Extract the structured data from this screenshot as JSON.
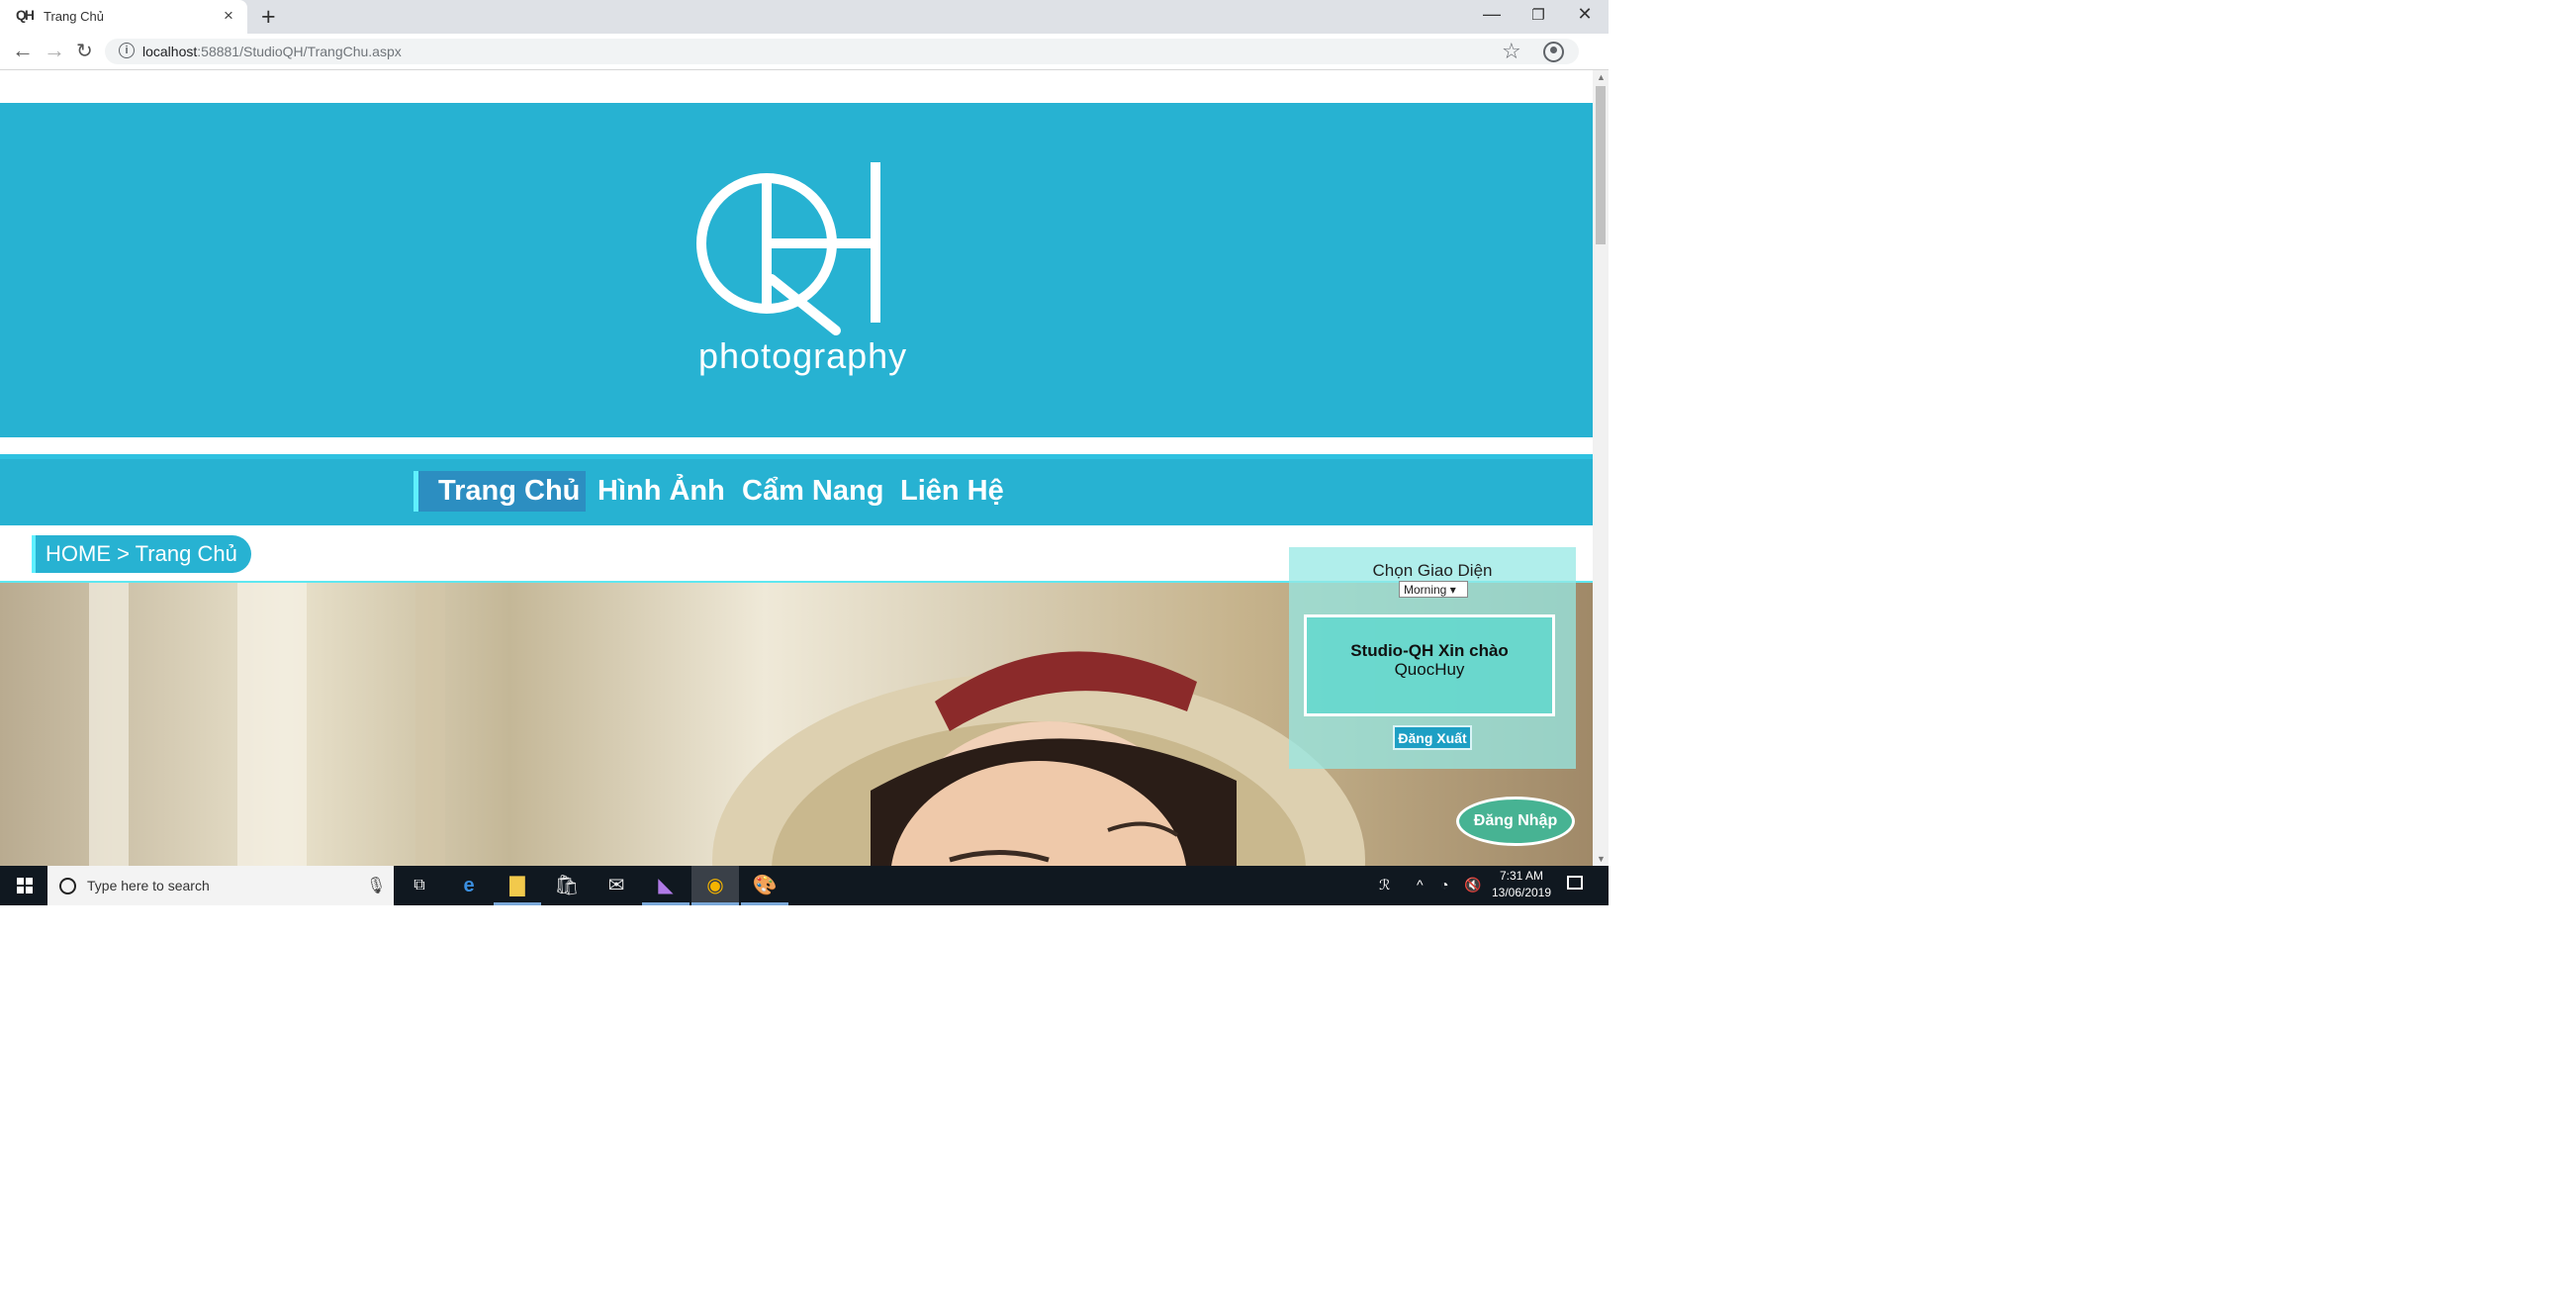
{
  "browser": {
    "tab_title": "Trang Chủ",
    "favicon_text": "QH",
    "tab_close": "×",
    "new_tab": "+",
    "window_min": "—",
    "window_restore": "❐",
    "window_close": "✕",
    "url_host": "localhost",
    "url_rest": ":58881/StudioQH/TrangChu.aspx",
    "back": "←",
    "forward": "→",
    "reload": "↻",
    "bookmark": "☆",
    "menu": "⋮",
    "info_glyph": "i"
  },
  "site": {
    "brand_text": "photography",
    "logo_letters": "QH",
    "accent_color": "#27b2d2",
    "nav": [
      {
        "label": "Trang Chủ"
      },
      {
        "label": "Hình Ảnh"
      },
      {
        "label": "Cẩm Nang"
      },
      {
        "label": "Liên Hệ"
      }
    ],
    "breadcrumb": "HOME > Trang Chủ",
    "panel": {
      "theme_label": "Chọn Giao Diện",
      "theme_selected": "Morning",
      "welcome": "Studio-QH Xin chào",
      "user": "QuocHuy",
      "logout": "Đăng Xuất"
    },
    "login": "Đăng Nhập"
  },
  "taskbar": {
    "search_placeholder": "Type here to search",
    "apps": [
      "task-view",
      "edge",
      "file-explorer",
      "store",
      "mail",
      "visual-studio",
      "chrome",
      "paint"
    ],
    "time": "7:31 AM",
    "date": "13/06/2019"
  }
}
